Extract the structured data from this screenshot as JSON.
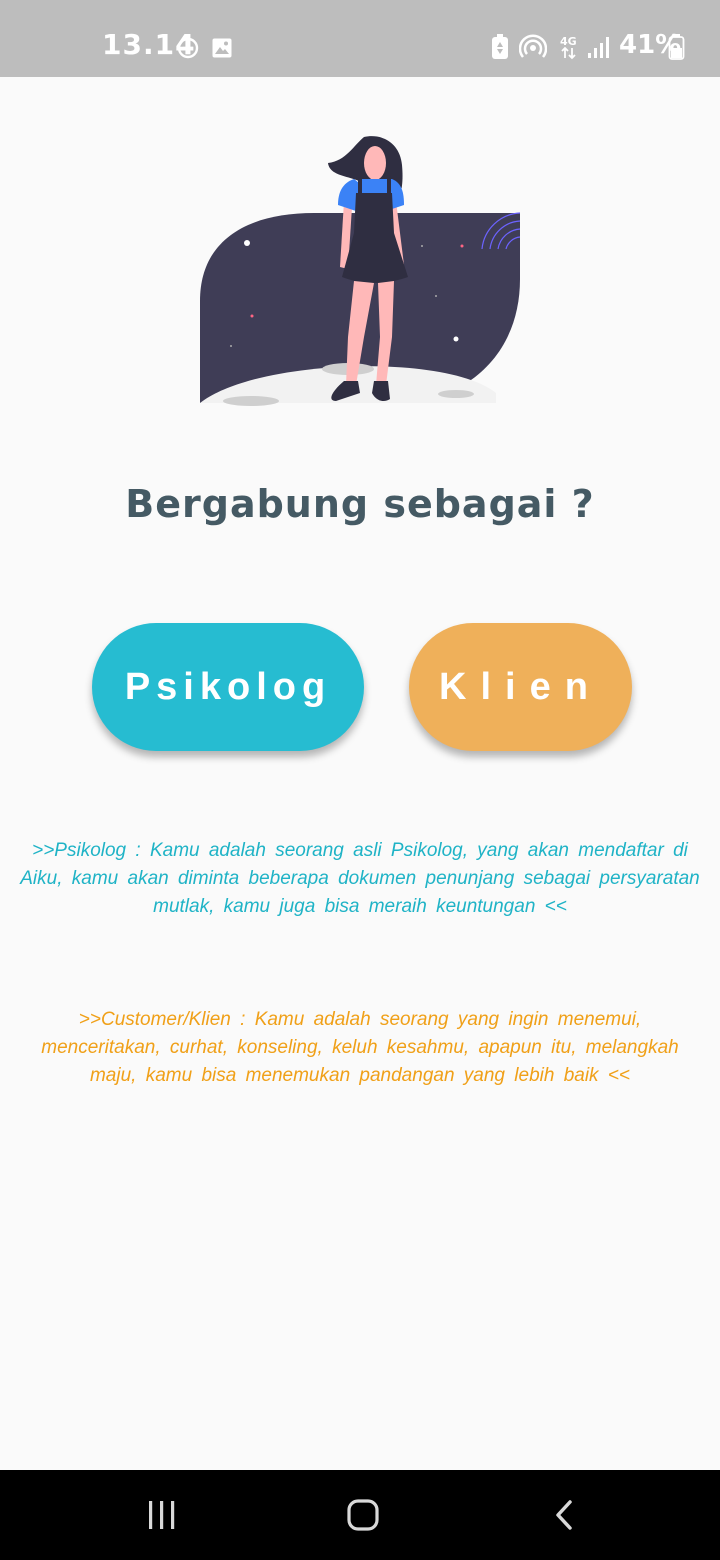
{
  "status_bar": {
    "time": "13.14",
    "battery": "41%",
    "network": "4G",
    "icons": [
      "do-not-disturb-icon",
      "gallery-icon",
      "battery-saver-icon",
      "hotspot-icon",
      "network-4g-icon",
      "signal-icon",
      "battery-icon"
    ]
  },
  "main": {
    "title": "Bergabung sebagai ?",
    "buttons": {
      "psikolog": "Psikolog",
      "klien": "Klien"
    },
    "descriptions": {
      "psikolog": ">>Psikolog : Kamu adalah seorang asli Psikolog, yang akan mendaftar di Aiku, kamu akan diminta beberapa dokumen penunjang sebagai persyaratan mutlak, kamu juga bisa meraih keuntungan <<",
      "klien": ">>Customer/Klien : Kamu adalah seorang yang ingin menemui, menceritakan, curhat, konseling, keluh kesahmu, apapun itu, melangkah maju,  kamu bisa menemukan pandangan yang lebih baik <<"
    }
  },
  "colors": {
    "psikolog": "#26bcd1",
    "klien": "#efb05a",
    "title": "#455a64"
  },
  "nav": {
    "icons": [
      "recent-apps-icon",
      "home-icon",
      "back-icon"
    ]
  }
}
